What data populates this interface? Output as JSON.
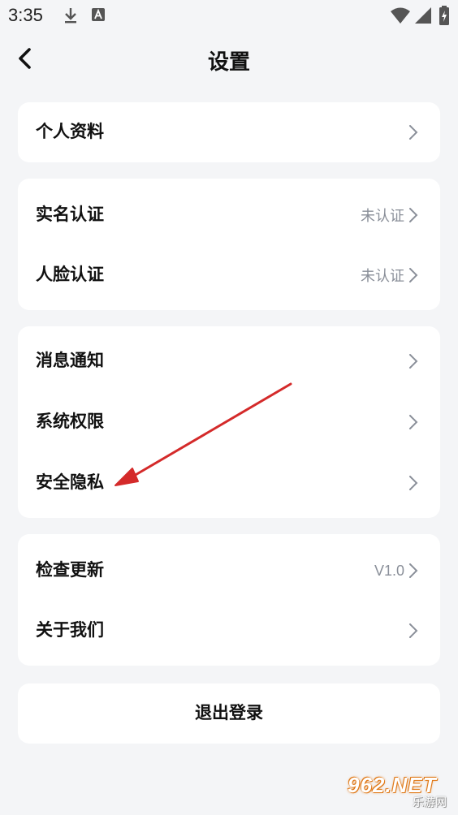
{
  "status_bar": {
    "time": "3:35",
    "icons": [
      "download-icon",
      "font-a-icon",
      "wifi-icon",
      "signal-icon",
      "battery-icon"
    ]
  },
  "header": {
    "title": "设置",
    "back_icon": "back-chevron-icon"
  },
  "sections": [
    {
      "rows": [
        {
          "label": "个人资料",
          "value": ""
        }
      ]
    },
    {
      "rows": [
        {
          "label": "实名认证",
          "value": "未认证"
        },
        {
          "label": "人脸认证",
          "value": "未认证"
        }
      ]
    },
    {
      "rows": [
        {
          "label": "消息通知",
          "value": ""
        },
        {
          "label": "系统权限",
          "value": ""
        },
        {
          "label": "安全隐私",
          "value": ""
        }
      ]
    },
    {
      "rows": [
        {
          "label": "检查更新",
          "value": "V1.0"
        },
        {
          "label": "关于我们",
          "value": ""
        }
      ]
    }
  ],
  "logout": {
    "label": "退出登录"
  },
  "annotation": {
    "color": "#d42a2a"
  },
  "watermark": {
    "main": "962.NET",
    "sub": "乐游网"
  },
  "colors": {
    "background": "#f4f5f7",
    "card": "#ffffff",
    "secondary_text": "#8a8f99"
  }
}
